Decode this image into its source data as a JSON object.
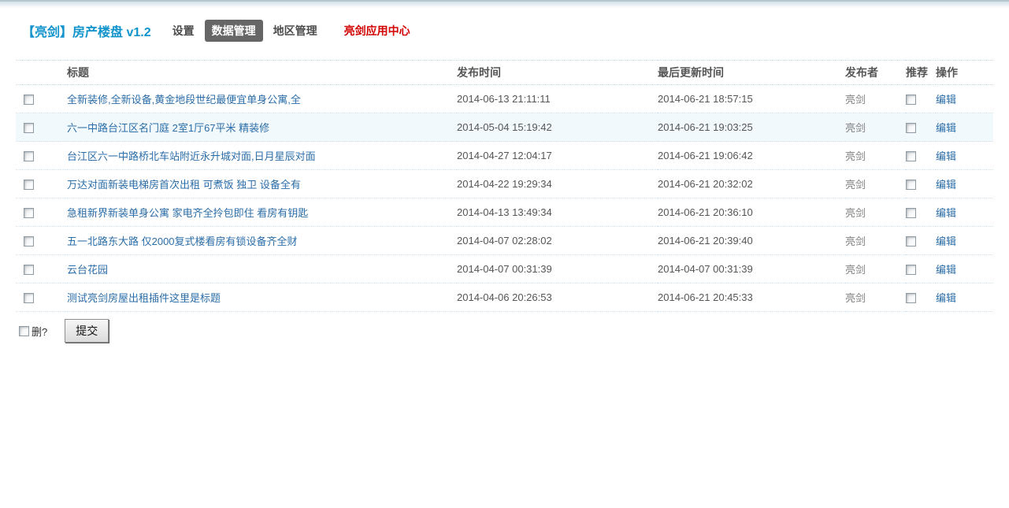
{
  "header": {
    "title": "【亮剑】房产楼盘 v1.2",
    "tabs": [
      {
        "label": "设置",
        "active": false,
        "accent": false
      },
      {
        "label": "数据管理",
        "active": true,
        "accent": false
      },
      {
        "label": "地区管理",
        "active": false,
        "accent": false
      },
      {
        "label": "亮剑应用中心",
        "active": false,
        "accent": true
      }
    ]
  },
  "table": {
    "columns": {
      "title": "标题",
      "publish_time": "发布时间",
      "update_time": "最后更新时间",
      "publisher": "发布者",
      "recommend": "推荐",
      "action": "操作"
    },
    "edit_label": "编辑",
    "rows": [
      {
        "title": "全新装修,全新设备,黄金地段世纪最便宜单身公寓,全",
        "publish_time": "2014-06-13 21:11:11",
        "update_time": "2014-06-21 18:57:15",
        "publisher": "亮剑",
        "recommend_checked": false,
        "highlighted": false
      },
      {
        "title": "六一中路台江区名门庭 2室1厅67平米 精装修",
        "publish_time": "2014-05-04 15:19:42",
        "update_time": "2014-06-21 19:03:25",
        "publisher": "亮剑",
        "recommend_checked": false,
        "highlighted": true
      },
      {
        "title": "台江区六一中路桥北车站附近永升城对面,日月星辰对面",
        "publish_time": "2014-04-27 12:04:17",
        "update_time": "2014-06-21 19:06:42",
        "publisher": "亮剑",
        "recommend_checked": false,
        "highlighted": false
      },
      {
        "title": "万达对面新装电梯房首次出租 可煮饭 独卫 设备全有",
        "publish_time": "2014-04-22 19:29:34",
        "update_time": "2014-06-21 20:32:02",
        "publisher": "亮剑",
        "recommend_checked": false,
        "highlighted": false
      },
      {
        "title": "急租新界新装单身公寓 家电齐全拎包即住 看房有钥匙",
        "publish_time": "2014-04-13 13:49:34",
        "update_time": "2014-06-21 20:36:10",
        "publisher": "亮剑",
        "recommend_checked": false,
        "highlighted": false
      },
      {
        "title": "五一北路东大路 仅2000复式楼看房有锁设备齐全财",
        "publish_time": "2014-04-07 02:28:02",
        "update_time": "2014-06-21 20:39:40",
        "publisher": "亮剑",
        "recommend_checked": false,
        "highlighted": false
      },
      {
        "title": "云台花园",
        "publish_time": "2014-04-07 00:31:39",
        "update_time": "2014-04-07 00:31:39",
        "publisher": "亮剑",
        "recommend_checked": false,
        "highlighted": false
      },
      {
        "title": "测试亮剑房屋出租插件这里是标题",
        "publish_time": "2014-04-06 20:26:53",
        "update_time": "2014-06-21 20:45:33",
        "publisher": "亮剑",
        "recommend_checked": false,
        "highlighted": false
      }
    ]
  },
  "footer": {
    "delete_label": "删?",
    "submit_label": "提交"
  },
  "colors": {
    "brand_blue": "#1193cc",
    "link_blue": "#2b6da8",
    "accent_red": "#d20000",
    "active_tab_bg": "#666666",
    "row_highlight": "#f2f9fd",
    "dotted_border": "#cfe0ea"
  }
}
